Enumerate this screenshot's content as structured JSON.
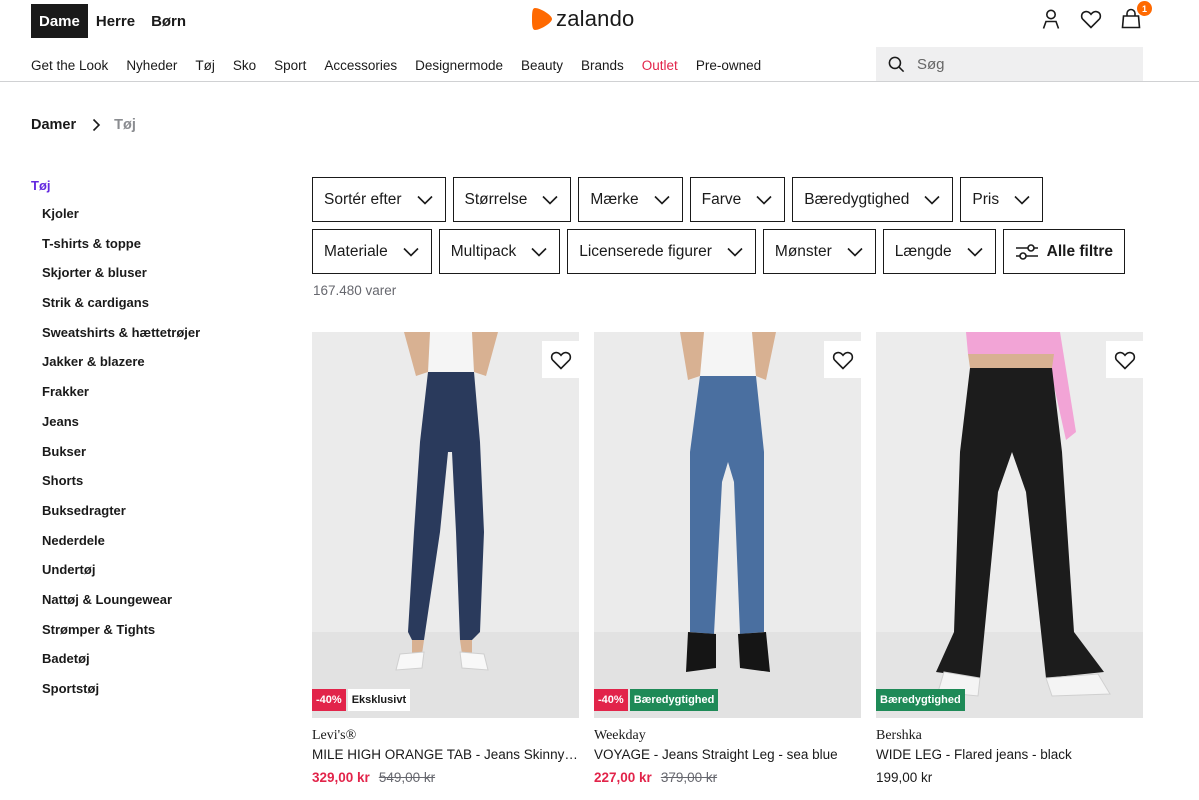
{
  "header": {
    "gender_tabs": [
      "Dame",
      "Herre",
      "Børn"
    ],
    "active_gender": "Dame",
    "logo_text": "zalando",
    "brand_color": "#ff6900",
    "cart_count": "1",
    "icons": [
      "user-icon",
      "heart-icon",
      "bag-icon"
    ]
  },
  "nav": {
    "items": [
      "Get the Look",
      "Nyheder",
      "Tøj",
      "Sko",
      "Sport",
      "Accessories",
      "Designermode",
      "Beauty",
      "Brands",
      "Outlet",
      "Pre-owned"
    ],
    "highlight": "Outlet",
    "highlight_color": "#e2244a"
  },
  "search": {
    "placeholder": "Søg"
  },
  "breadcrumb": {
    "root": "Damer",
    "current": "Tøj"
  },
  "sidebar": {
    "heading": "Tøj",
    "accent_color": "#6328e0",
    "items": [
      "Kjoler",
      "T-shirts & toppe",
      "Skjorter & bluser",
      "Strik & cardigans",
      "Sweatshirts & hættetrøjer",
      "Jakker & blazere",
      "Frakker",
      "Jeans",
      "Bukser",
      "Shorts",
      "Buksedragter",
      "Nederdele",
      "Undertøj",
      "Nattøj & Loungewear",
      "Strømper & Tights",
      "Badetøj",
      "Sportstøj"
    ]
  },
  "filters": {
    "row1": [
      "Sortér efter",
      "Størrelse",
      "Mærke",
      "Farve",
      "Bæredygtighed",
      "Pris"
    ],
    "row2": [
      "Materiale",
      "Multipack",
      "Licenserede figurer",
      "Mønster",
      "Længde"
    ],
    "all_filters": "Alle filtre"
  },
  "result_count": "167.480 varer",
  "products": [
    {
      "brand": "Levi's®",
      "name": "MILE HIGH ORANGE TAB - Jeans Skinny Fit - dark",
      "badges": [
        {
          "type": "discount",
          "text": "-40%"
        },
        {
          "type": "exclusive",
          "text": "Eksklusivt"
        }
      ],
      "price": "329,00 kr",
      "original_price": "549,00 kr",
      "jeans_color": "#2a3a5c",
      "top_color": "#ffffff"
    },
    {
      "brand": "Weekday",
      "name": "VOYAGE - Jeans Straight Leg - sea blue",
      "badges": [
        {
          "type": "discount",
          "text": "-40%"
        },
        {
          "type": "sustain",
          "text": "Bæredygtighed"
        }
      ],
      "price": "227,00 kr",
      "original_price": "379,00 kr",
      "jeans_color": "#4a6fa0",
      "top_color": "#ffffff"
    },
    {
      "brand": "Bershka",
      "name": "WIDE LEG - Flared jeans - black",
      "badges": [
        {
          "type": "sustain",
          "text": "Bæredygtighed"
        }
      ],
      "price": "199,00 kr",
      "original_price": "",
      "jeans_color": "#1c1c1c",
      "top_color": "#f2a4d6"
    }
  ]
}
